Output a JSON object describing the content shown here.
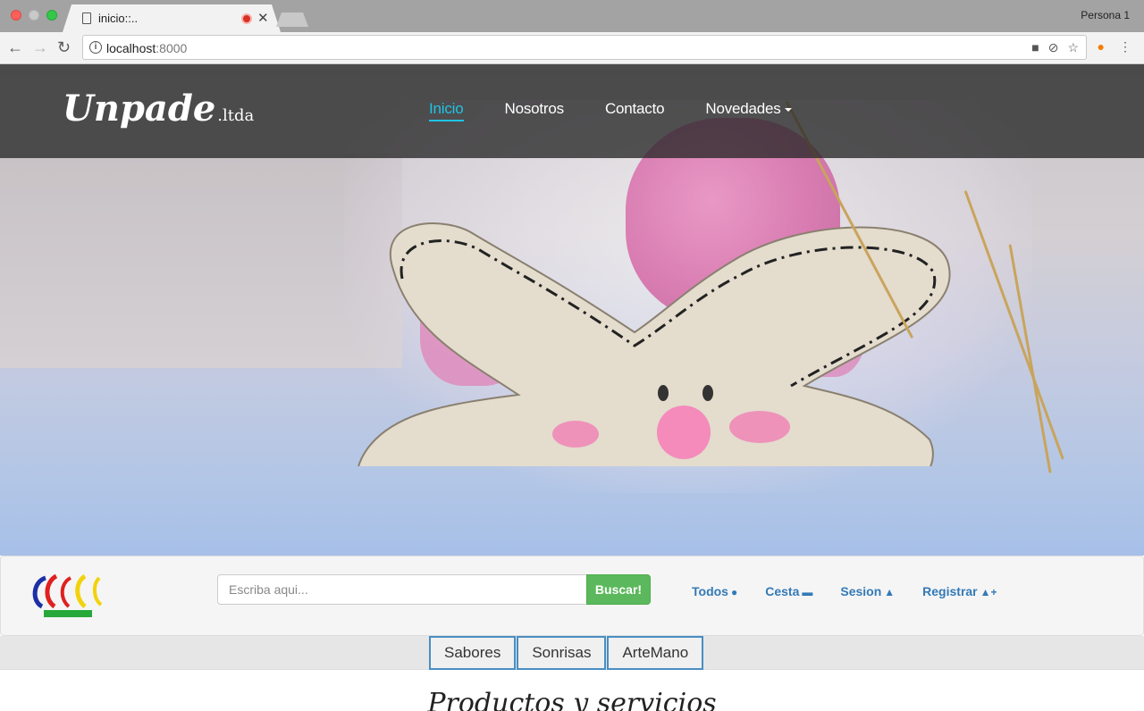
{
  "browser": {
    "tab_title": "inicio::..",
    "profile": "Persona 1",
    "url_host": "localhost",
    "url_port": ":8000"
  },
  "nav": {
    "brand": "Unpade",
    "brand_suffix": ".ltda",
    "links": [
      "Inicio",
      "Nosotros",
      "Contacto",
      "Novedades"
    ]
  },
  "search": {
    "placeholder": "Escriba aqui...",
    "button": "Buscar!",
    "links": [
      "Todos",
      "Cesta",
      "Sesion",
      "Registrar"
    ]
  },
  "categories": [
    "Sabores",
    "Sonrisas",
    "ArteMano"
  ],
  "section_title": "Productos y servicios"
}
